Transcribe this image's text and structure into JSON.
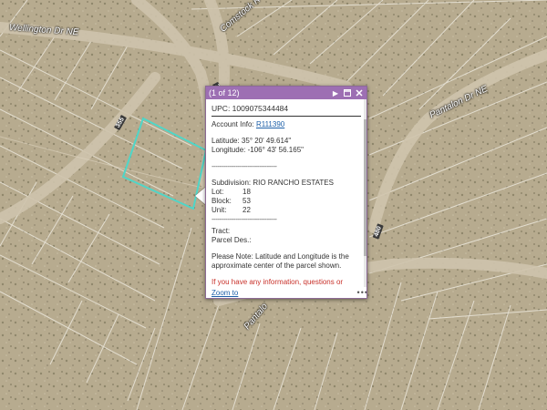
{
  "map": {
    "roads": {
      "wellington": "Wellington Dr NE",
      "comstock": "Comstock R",
      "pantalon_ne": "Pantalon Dr NE",
      "pantalon_s": "Pantalo"
    },
    "shields": {
      "a": "355",
      "b": "356",
      "c": "480"
    },
    "colors": {
      "ground": "#b7ab8f",
      "road": "#cfc4ad",
      "parcel_lines": "#f2efe6",
      "selection": "#4fd6c8"
    }
  },
  "popup": {
    "header": {
      "count": "(1 of 12)",
      "accent": "#9d6fb3"
    },
    "upc": "UPC: 1009075344484",
    "account_label": "Account Info:",
    "account_value": "R111390",
    "latitude": "Latitude: 35° 20' 49.614\"",
    "longitude": "Longitude: -106° 43' 56.165\"",
    "divider_1": "---------------------------------",
    "subdivision": "Subdivision: RIO RANCHO ESTATES",
    "lot_label": "Lot:",
    "lot_value": "18",
    "block_label": "Block:",
    "block_value": "53",
    "unit_label": "Unit:",
    "unit_value": "22",
    "divider_2": "---------------------------------",
    "tract": "Tract:",
    "parcel_des": "Parcel Des.:",
    "note": "Please Note: Latitude and Longitude is the approximate center of the parcel shown.",
    "contact": "If you have any information, questions or concerns about this parcel, please contact",
    "zoom_to": "Zoom to",
    "more": "•••"
  }
}
